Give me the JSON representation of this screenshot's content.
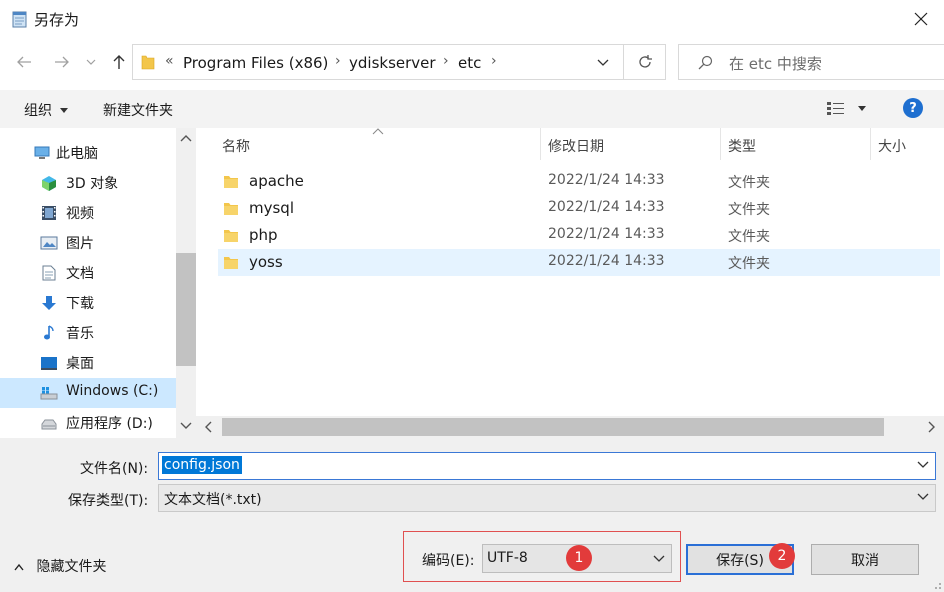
{
  "window": {
    "title": "另存为"
  },
  "address": {
    "overflow": "«",
    "crumbs": [
      "Program Files (x86)",
      "ydiskserver",
      "etc"
    ]
  },
  "search": {
    "placeholder": "在 etc 中搜索"
  },
  "toolbar": {
    "organize": "组织",
    "new_folder": "新建文件夹"
  },
  "sidebar": {
    "items": [
      {
        "label": "此电脑",
        "icon": "computer-icon"
      },
      {
        "label": "3D 对象",
        "icon": "3d-objects-icon"
      },
      {
        "label": "视频",
        "icon": "video-icon"
      },
      {
        "label": "图片",
        "icon": "pictures-icon"
      },
      {
        "label": "文档",
        "icon": "documents-icon"
      },
      {
        "label": "下载",
        "icon": "download-icon"
      },
      {
        "label": "音乐",
        "icon": "music-icon"
      },
      {
        "label": "桌面",
        "icon": "desktop-icon"
      },
      {
        "label": "Windows (C:)",
        "icon": "drive-c-icon",
        "selected": true
      },
      {
        "label": "应用程序 (D:)",
        "icon": "drive-d-icon"
      }
    ]
  },
  "filelist": {
    "columns": {
      "name": "名称",
      "modified": "修改日期",
      "type": "类型",
      "size": "大小"
    },
    "rows": [
      {
        "name": "apache",
        "modified": "2022/1/24 14:33",
        "type": "文件夹"
      },
      {
        "name": "mysql",
        "modified": "2022/1/24 14:33",
        "type": "文件夹"
      },
      {
        "name": "php",
        "modified": "2022/1/24 14:33",
        "type": "文件夹"
      },
      {
        "name": "yoss",
        "modified": "2022/1/24 14:33",
        "type": "文件夹",
        "selected": true
      }
    ]
  },
  "form": {
    "filename_label": "文件名(N):",
    "filename_value": "config.json",
    "filetype_label": "保存类型(T):",
    "filetype_value": "文本文档(*.txt)",
    "hide_folders": "隐藏文件夹",
    "encoding_label": "编码(E):",
    "encoding_value": "UTF-8",
    "save": "保存(S)",
    "cancel": "取消",
    "badge1": "1",
    "badge2": "2"
  },
  "colors": {
    "accent": "#0078d7",
    "selection": "#cce8ff",
    "annotation": "#e23b3b"
  }
}
